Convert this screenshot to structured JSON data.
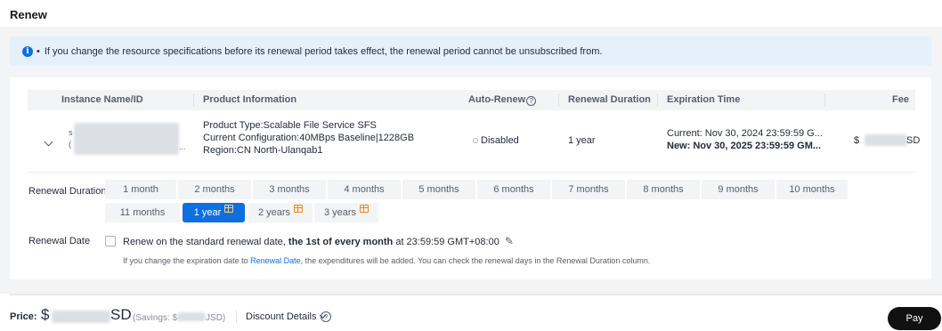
{
  "page": {
    "title": "Renew"
  },
  "notice": {
    "bullet": "•",
    "text": "If you change the resource specifications before its renewal period takes effect, the renewal period cannot be unsubscribed from."
  },
  "table": {
    "headers": {
      "instance": "Instance Name/ID",
      "product": "Product Information",
      "auto_renew": "Auto-Renew",
      "duration": "Renewal Duration",
      "expiration": "Expiration Time",
      "fee": "Fee"
    },
    "row": {
      "name_prefix": "s",
      "id_prefix": "(",
      "id_suffix": "...",
      "product_type": "Product Type:Scalable File Service SFS",
      "configuration": "Current Configuration:40MBps Baseline|1228GB",
      "region": "Region:CN North-Ulanqab1",
      "auto_renew": "Disabled",
      "duration": "1 year",
      "current_expiration": "Current: Nov 30, 2024 23:59:59 G...",
      "new_expiration": "New: Nov 30, 2025 23:59:59 GM...",
      "fee_prefix": "$",
      "fee_suffix": "SD"
    }
  },
  "renewal": {
    "duration_label": "Renewal Duration",
    "options": [
      "1 month",
      "2 months",
      "3 months",
      "4 months",
      "5 months",
      "6 months",
      "7 months",
      "8 months",
      "9 months",
      "10 months",
      "11 months",
      "1 year",
      "2 years",
      "3 years"
    ],
    "selected": "1 year",
    "gift_icon": "gift-icon",
    "date_label": "Renewal Date",
    "renew_text_1": "Renew on the standard renewal date, ",
    "renew_text_bold": "the 1st of every month",
    "renew_text_2": " at 23:59:59 GMT+08:00",
    "hint_1": "If you change the expiration date to ",
    "hint_link": "Renewal Date",
    "hint_2": ", the expenditures will be added. You can check the renewal days in the Renewal Duration column."
  },
  "footer": {
    "price_label": "Price:",
    "price_prefix": "$",
    "price_suffix": "SD",
    "savings_prefix": "(Savings: $",
    "savings_suffix": "JSD)",
    "discount_label": "Discount Details",
    "pay_label": "Pay"
  },
  "colors": {
    "accent": "#0e6fe0",
    "notice_bg": "#e5f0fd",
    "gift": "#e88a12",
    "pay_button": "#111111"
  }
}
